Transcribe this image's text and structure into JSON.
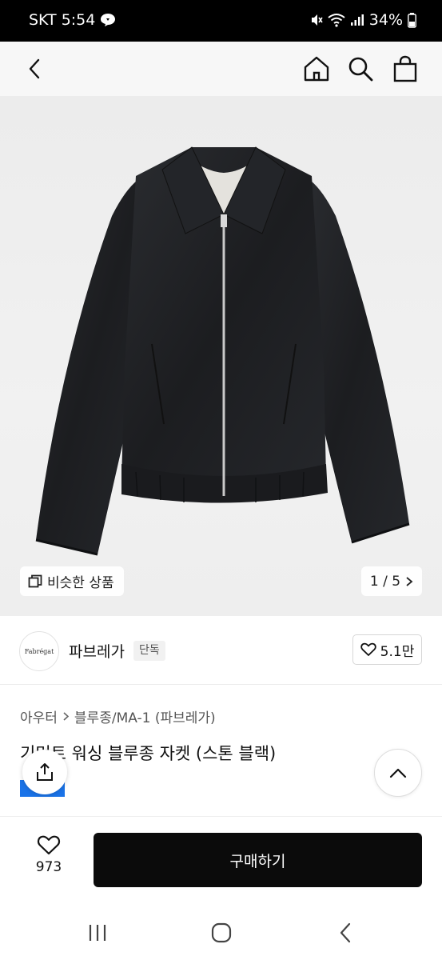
{
  "status_bar": {
    "carrier_time": "SKT 5:54",
    "battery": "34%"
  },
  "header": {
    "back_icon": "chevron-left-icon",
    "home_icon": "home-icon",
    "search_icon": "search-icon",
    "cart_icon": "shopping-bag-icon"
  },
  "gallery": {
    "similar_label": "비슷한 상품",
    "pager": "1 / 5"
  },
  "brand": {
    "logo_text": "Fabrégat",
    "name": "파브레가",
    "badge": "단독",
    "likes": "5.1만"
  },
  "breadcrumb": {
    "level1": "아우터",
    "level2": "블루종/MA-1 (파브레가)"
  },
  "product": {
    "title": "기먼트 워싱 블루종 자켓 (스톤 블랙)"
  },
  "bottom": {
    "like_count": "973",
    "buy_label": "구매하기"
  },
  "colors": {
    "buy_button": "#0b0b0b",
    "blue_tag": "#1a73e8"
  }
}
